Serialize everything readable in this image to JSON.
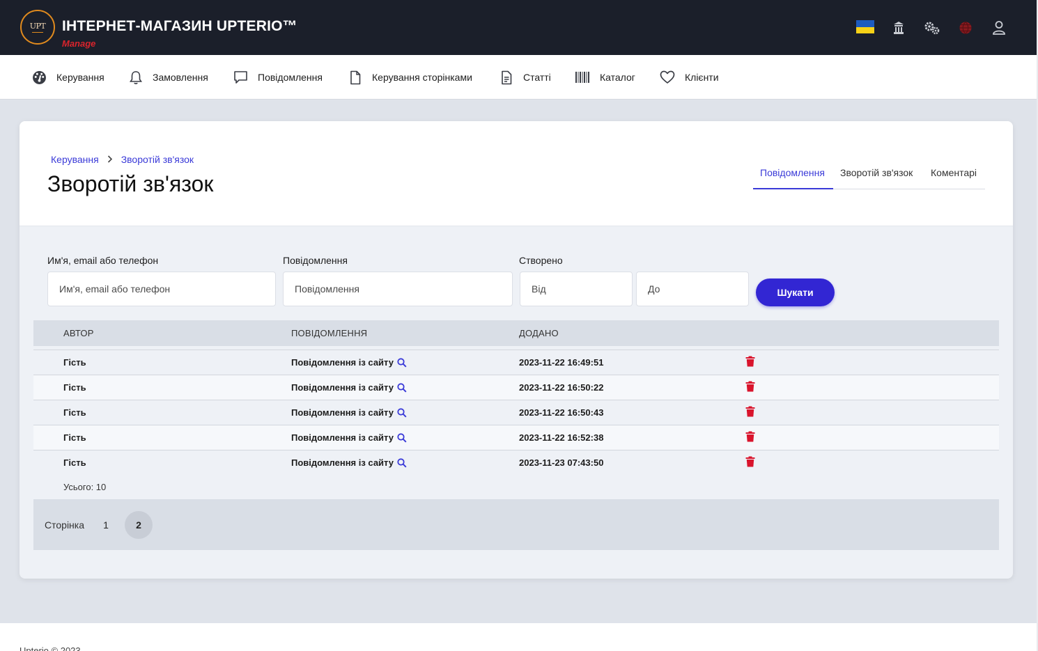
{
  "header": {
    "logo_text": "UPT",
    "brand_title": "ІНТЕРНЕТ-МАГАЗИН UPTERIO™",
    "brand_sub": "Manage",
    "icons": [
      "ukraine-flag-icon",
      "building-icon",
      "gears-icon",
      "globe-icon",
      "user-icon"
    ]
  },
  "nav": {
    "items": [
      {
        "label": "Керування",
        "icon": "dashboard-icon"
      },
      {
        "label": "Замовлення",
        "icon": "bell-icon"
      },
      {
        "label": "Повідомлення",
        "icon": "chat-icon"
      },
      {
        "label": "Керування сторінками",
        "icon": "page-icon"
      },
      {
        "label": "Статті",
        "icon": "document-icon"
      },
      {
        "label": "Каталог",
        "icon": "barcode-icon"
      },
      {
        "label": "Клієнти",
        "icon": "heart-icon"
      }
    ]
  },
  "breadcrumb": {
    "items": [
      "Керування",
      "Зворотій зв'язок"
    ]
  },
  "page_title": "Зворотій зв'язок",
  "tabs": [
    {
      "label": "Повідомлення",
      "active": true
    },
    {
      "label": "Зворотій зв'язок",
      "active": false
    },
    {
      "label": "Коментарі",
      "active": false
    }
  ],
  "filters": {
    "name_label": "Им'я, email або телефон",
    "name_placeholder": "Им'я, email або телефон",
    "message_label": "Повідомлення",
    "message_placeholder": "Повідомлення",
    "created_label": "Створено",
    "from_placeholder": "Від",
    "to_placeholder": "До",
    "search_button": "Шукати"
  },
  "table": {
    "columns": [
      "Автор",
      "Повідомлення",
      "Додано"
    ],
    "rows": [
      {
        "author": "Гість",
        "message": "Повідомлення із сайту",
        "added": "2023-11-22 16:49:51"
      },
      {
        "author": "Гість",
        "message": "Повідомлення із сайту",
        "added": "2023-11-22 16:50:22"
      },
      {
        "author": "Гість",
        "message": "Повідомлення із сайту",
        "added": "2023-11-22 16:50:43"
      },
      {
        "author": "Гість",
        "message": "Повідомлення із сайту",
        "added": "2023-11-22 16:52:38"
      },
      {
        "author": "Гість",
        "message": "Повідомлення із сайту",
        "added": "2023-11-23 07:43:50"
      }
    ],
    "total": "Усього: 10"
  },
  "pagination": {
    "label": "Сторінка",
    "pages": [
      "1",
      "2"
    ],
    "current": "2"
  },
  "footer": {
    "text": "Upterio © 2023"
  },
  "colors": {
    "accent": "#3226d3",
    "danger": "#d9142c",
    "topbar": "#1b1f2a"
  }
}
